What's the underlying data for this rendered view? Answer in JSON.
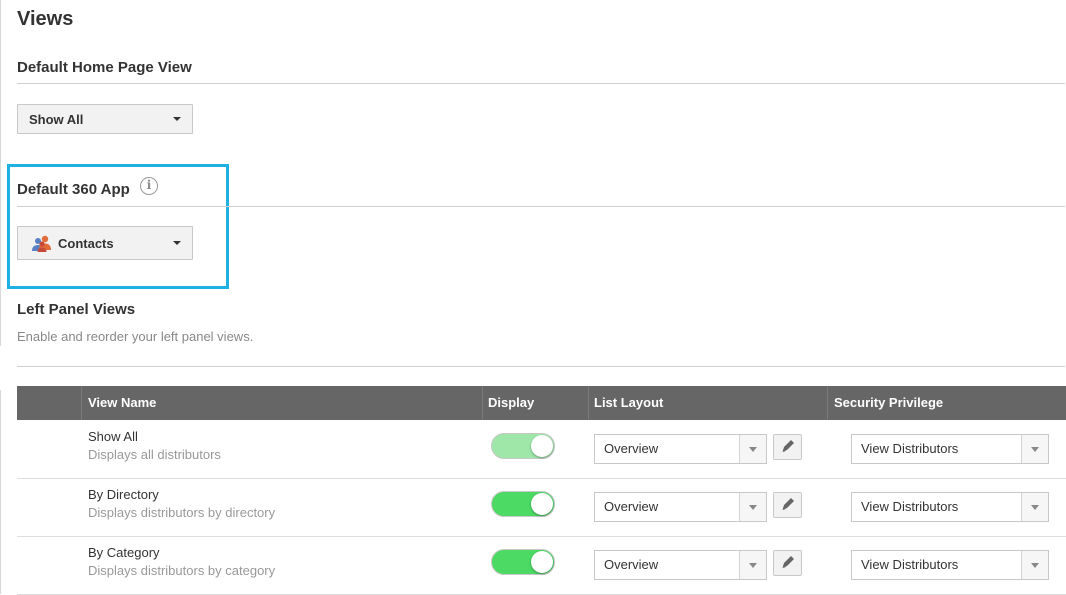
{
  "page": {
    "title": "Views"
  },
  "home_view": {
    "section_title": "Default Home Page View",
    "selected": "Show All"
  },
  "app360": {
    "section_title": "Default 360 App",
    "info_icon": "info-icon",
    "selected": "Contacts",
    "selected_icon": "contacts-icon"
  },
  "left_panel": {
    "section_title": "Left Panel Views",
    "subtitle": "Enable and reorder your left panel views."
  },
  "table": {
    "headers": {
      "view_name": "View Name",
      "display": "Display",
      "list_layout": "List Layout",
      "security_privilege": "Security Privilege"
    },
    "rows": [
      {
        "name": "Show All",
        "description": "Displays all distributors",
        "display_on": true,
        "display_enabled": false,
        "layout": "Overview",
        "privilege": "View Distributors"
      },
      {
        "name": "By Directory",
        "description": "Displays distributors by directory",
        "display_on": true,
        "display_enabled": true,
        "layout": "Overview",
        "privilege": "View Distributors"
      },
      {
        "name": "By Category",
        "description": "Displays distributors by category",
        "display_on": true,
        "display_enabled": true,
        "layout": "Overview",
        "privilege": "View Distributors"
      }
    ]
  },
  "colors": {
    "highlight": "#1fb1e3",
    "header_bg": "#666666",
    "toggle_on": "#4cd964"
  }
}
